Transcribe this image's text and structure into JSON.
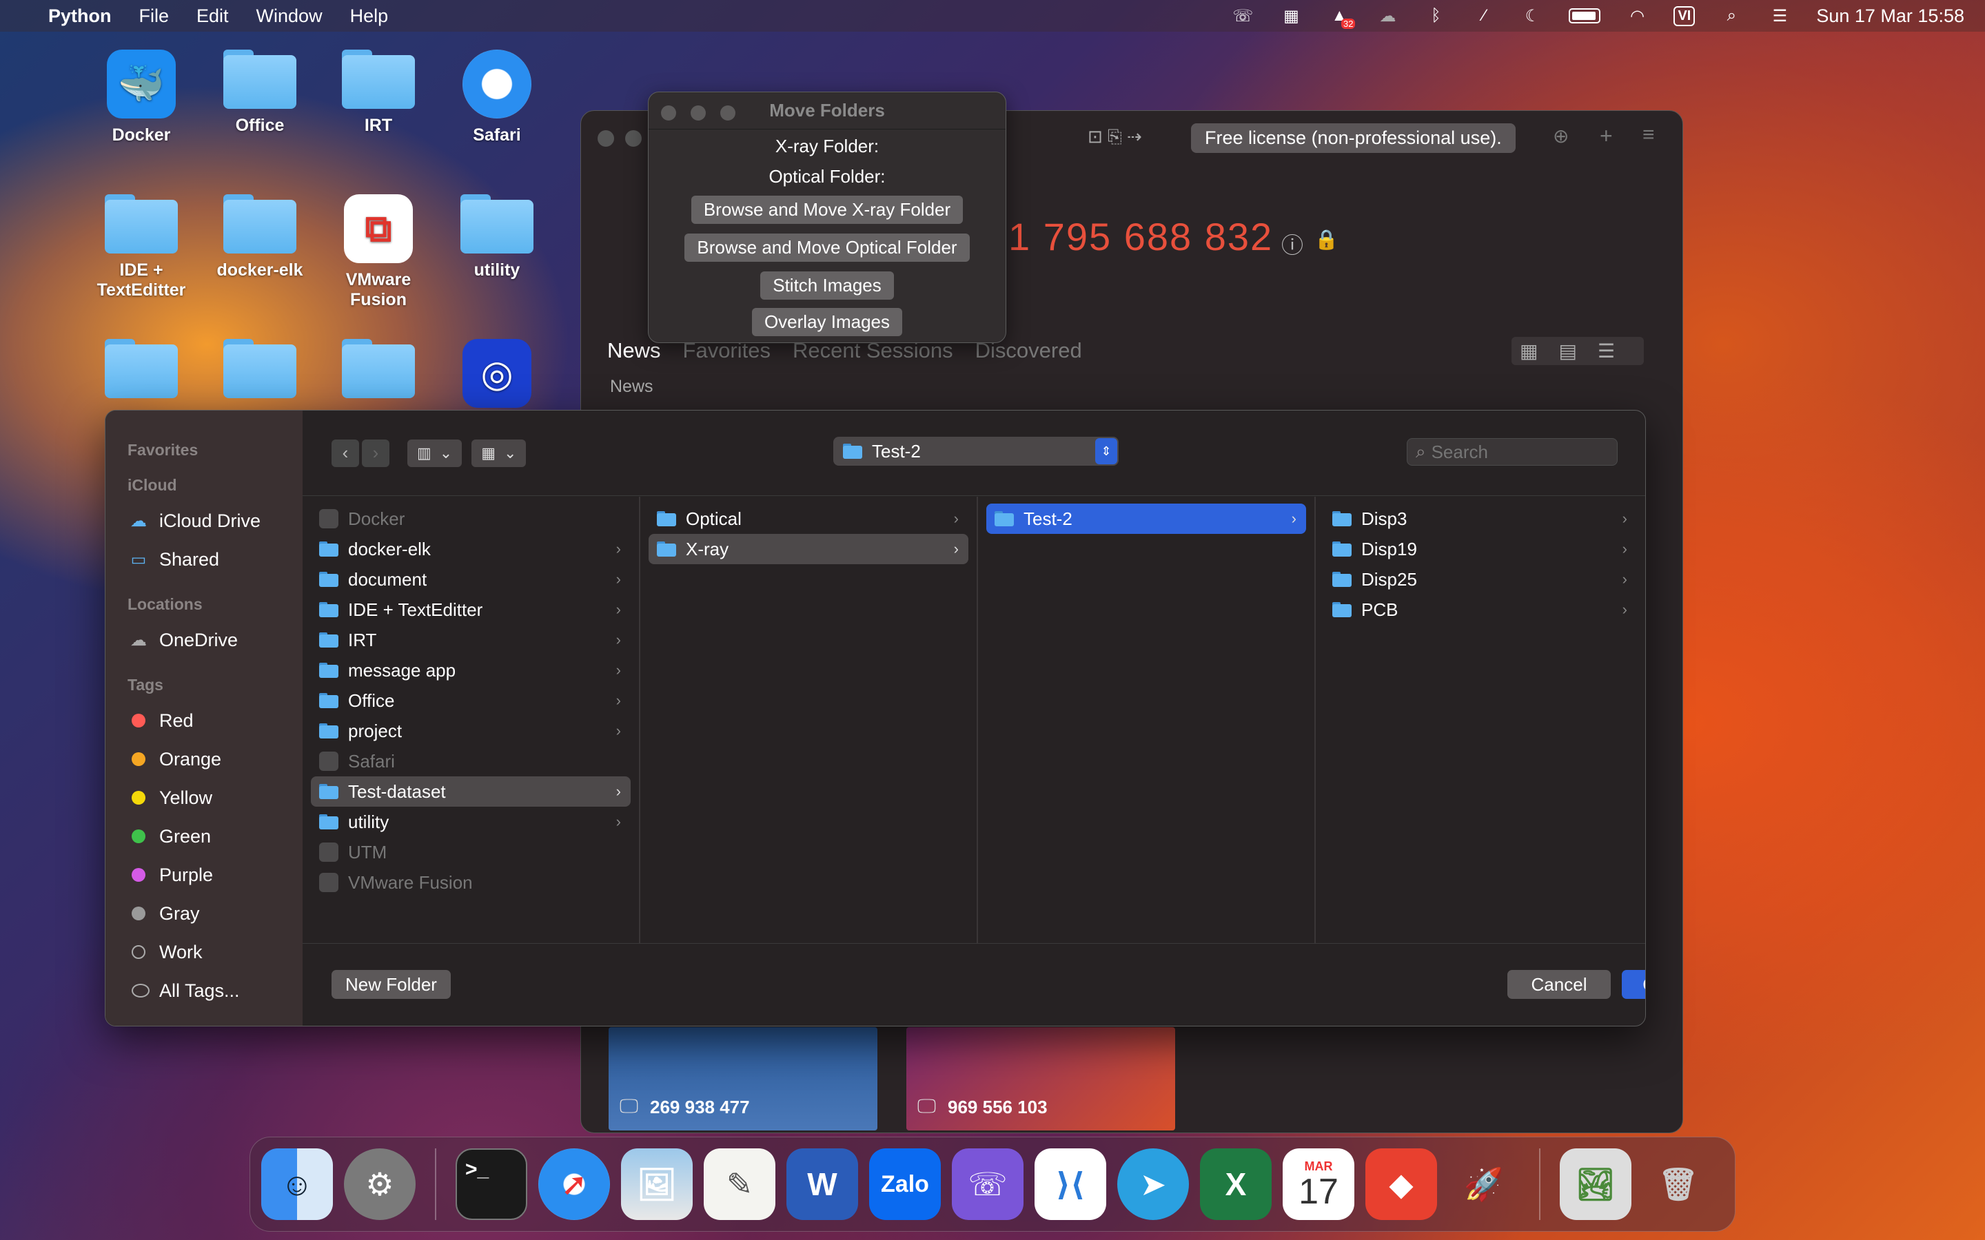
{
  "menubar": {
    "app_name": "Python",
    "items": [
      "File",
      "Edit",
      "Window",
      "Help"
    ],
    "badge": "32",
    "input_source": "VI",
    "datetime": "Sun 17 Mar  15:58"
  },
  "desktop": {
    "icons": [
      {
        "label": "Docker",
        "kind": "docker-app"
      },
      {
        "label": "Office",
        "kind": "folder"
      },
      {
        "label": "IRT",
        "kind": "folder"
      },
      {
        "label": "Safari",
        "kind": "safari-app"
      },
      {
        "label": "IDE +\nTextEditter",
        "kind": "folder"
      },
      {
        "label": "docker-elk",
        "kind": "folder"
      },
      {
        "label": "VMware\nFusion",
        "kind": "vmware-app"
      },
      {
        "label": "utility",
        "kind": "folder"
      }
    ]
  },
  "background_window": {
    "license": "Free license (non-professional use).",
    "id_number": "1 795 688 832",
    "tabs": [
      "News",
      "Favorites",
      "Recent Sessions",
      "Discovered"
    ],
    "section": "News",
    "tiles": [
      "269 938 477",
      "969 556 103"
    ]
  },
  "move_folders": {
    "title": "Move Folders",
    "xray_label": "X-ray Folder:",
    "optical_label": "Optical Folder:",
    "buttons": {
      "browse_xray": "Browse and Move X-ray Folder",
      "browse_optical": "Browse and Move Optical Folder",
      "stitch": "Stitch Images",
      "overlay": "Overlay Images"
    }
  },
  "dialog": {
    "sidebar": {
      "favorites_heading": "Favorites",
      "icloud_heading": "iCloud",
      "icloud_drive": "iCloud Drive",
      "shared": "Shared",
      "locations_heading": "Locations",
      "onedrive": "OneDrive",
      "tags_heading": "Tags",
      "tags": [
        {
          "name": "Red",
          "color": "#ff5b55"
        },
        {
          "name": "Orange",
          "color": "#f5a623"
        },
        {
          "name": "Yellow",
          "color": "#f5d90a"
        },
        {
          "name": "Green",
          "color": "#3fc24b"
        },
        {
          "name": "Purple",
          "color": "#d45be6"
        },
        {
          "name": "Gray",
          "color": "#9a9a9a"
        },
        {
          "name": "Work",
          "color": "hollow"
        },
        {
          "name": "All Tags...",
          "color": "alltags"
        }
      ]
    },
    "path": "Test-2",
    "search_placeholder": "Search",
    "columns": [
      [
        {
          "name": "Docker",
          "type": "app",
          "dim": true
        },
        {
          "name": "docker-elk",
          "type": "folder"
        },
        {
          "name": "document",
          "type": "folder"
        },
        {
          "name": "IDE + TextEditter",
          "type": "folder"
        },
        {
          "name": "IRT",
          "type": "folder"
        },
        {
          "name": "message app",
          "type": "folder"
        },
        {
          "name": "Office",
          "type": "folder"
        },
        {
          "name": "project",
          "type": "folder"
        },
        {
          "name": "Safari",
          "type": "app",
          "dim": true
        },
        {
          "name": "Test-dataset",
          "type": "folder",
          "selected": "gray"
        },
        {
          "name": "utility",
          "type": "folder"
        },
        {
          "name": "UTM",
          "type": "app",
          "dim": true
        },
        {
          "name": "VMware Fusion",
          "type": "app",
          "dim": true
        }
      ],
      [
        {
          "name": "Optical",
          "type": "folder"
        },
        {
          "name": "X-ray",
          "type": "folder",
          "selected": "gray"
        }
      ],
      [
        {
          "name": "Test-2",
          "type": "folder",
          "selected": "blue"
        }
      ],
      [
        {
          "name": "Disp3",
          "type": "folder"
        },
        {
          "name": "Disp19",
          "type": "folder"
        },
        {
          "name": "Disp25",
          "type": "folder"
        },
        {
          "name": "PCB",
          "type": "folder"
        }
      ]
    ],
    "new_folder": "New Folder",
    "cancel": "Cancel",
    "choose": "Choose"
  },
  "dock": {
    "calendar_month": "MAR",
    "calendar_day": "17",
    "apps": [
      "finder",
      "system-settings",
      "terminal",
      "safari",
      "preview",
      "textedit",
      "word",
      "zalo",
      "viber",
      "vscode",
      "telegram",
      "excel",
      "calendar",
      "anydesk",
      "python",
      "photos",
      "trash"
    ],
    "terminal_label": ">_",
    "zalo_label": "Zalo"
  }
}
